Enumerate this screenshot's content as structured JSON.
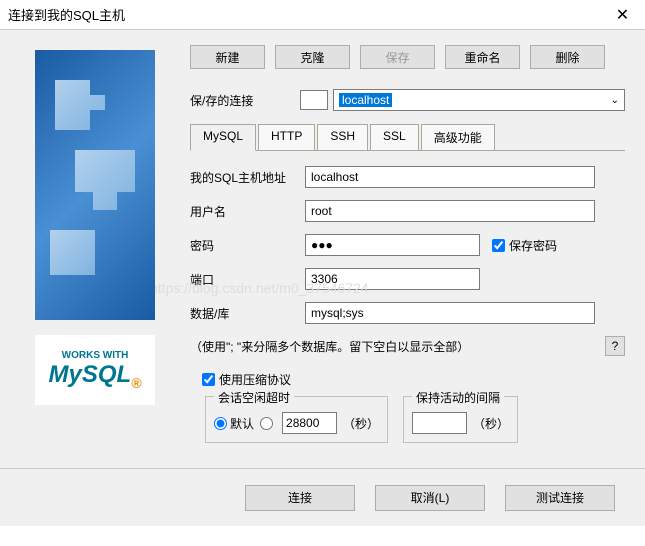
{
  "title": "连接到我的SQL主机",
  "top_buttons": {
    "new": "新建",
    "clone": "克隆",
    "save": "保存",
    "rename": "重命名",
    "delete": "删除"
  },
  "saved_conn": {
    "label": "保/存的连接",
    "value": "localhost"
  },
  "tabs": {
    "mysql": "MySQL",
    "http": "HTTP",
    "ssh": "SSH",
    "ssl": "SSL",
    "advanced": "高级功能"
  },
  "fields": {
    "host_label": "我的SQL主机地址",
    "host_value": "localhost",
    "user_label": "用户名",
    "user_value": "root",
    "password_label": "密码",
    "password_value": "●●●",
    "save_password": "保存密码",
    "port_label": "端口",
    "port_value": "3306",
    "database_label": "数据/库",
    "database_value": "mysql;sys"
  },
  "hint": "（使用\"; \"来分隔多个数据库。留下空白以显示全部）",
  "help_btn": "?",
  "compress": "使用压缩协议",
  "session_timeout": {
    "title": "会话空闲超时",
    "default": "默认",
    "value": "28800",
    "unit": "（秒）"
  },
  "keepalive": {
    "title": "保持活动的间隔",
    "value": "",
    "unit": "（秒）"
  },
  "footer": {
    "connect": "连接",
    "cancel": "取消(L)",
    "test": "测试连接"
  },
  "logo": {
    "works_with": "WORKS WITH",
    "mysql": "MySQL"
  },
  "watermark": "https://blog.csdn.net/m0_37546724"
}
